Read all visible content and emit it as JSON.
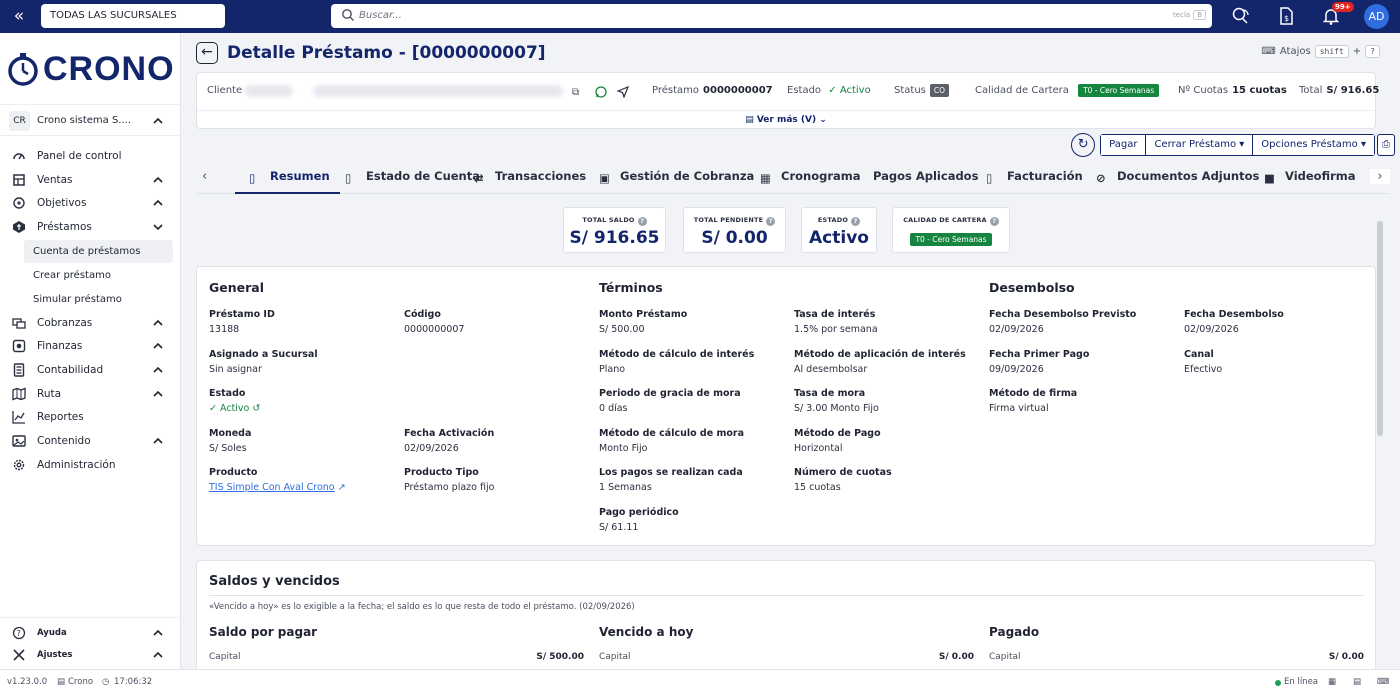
{
  "topbar": {
    "branch": "TODAS LAS SUCURSALES",
    "search_placeholder": "Buscar...",
    "search_hint": "tecla",
    "search_key": "B",
    "notifications": "99+",
    "user_initials": "AD"
  },
  "brand": {
    "name": "CRONO",
    "color": "#13256b"
  },
  "company": {
    "initials": "CR",
    "name": "Crono sistema S...."
  },
  "nav": [
    {
      "label": "Panel de control",
      "icon": "dashboard-icon"
    },
    {
      "label": "Ventas",
      "icon": "cart-icon",
      "chevron": "up"
    },
    {
      "label": "Objetivos",
      "icon": "target-icon",
      "chevron": "up"
    },
    {
      "label": "Préstamos",
      "icon": "loan-icon",
      "chevron": "down"
    },
    {
      "label": "Cobranzas",
      "icon": "collections-icon",
      "chevron": "up"
    },
    {
      "label": "Finanzas",
      "icon": "finance-icon",
      "chevron": "up"
    },
    {
      "label": "Contabilidad",
      "icon": "accounting-icon",
      "chevron": "up"
    },
    {
      "label": "Ruta",
      "icon": "map-icon",
      "chevron": "up"
    },
    {
      "label": "Reportes",
      "icon": "chart-icon"
    },
    {
      "label": "Contenido",
      "icon": "content-icon",
      "chevron": "up"
    },
    {
      "label": "Administración",
      "icon": "gear-icon"
    }
  ],
  "loan_sub": [
    "Cuenta de préstamos",
    "Crear préstamo",
    "Simular préstamo"
  ],
  "footer_nav": [
    {
      "label": "Ayuda"
    },
    {
      "label": "Ajustes"
    }
  ],
  "statusbar": {
    "version": "v1.23.0.0",
    "app": "Crono",
    "time": "17:06:32",
    "online": "En línea"
  },
  "page": {
    "title": "Detalle Préstamo - [0000000007]",
    "shortcuts_label": "Atajos",
    "shortcut_key": "shift",
    "shortcut_plus": "+",
    "shortcut_q": "?"
  },
  "client": {
    "label": "Cliente",
    "loan_label": "Préstamo",
    "loan_value": "0000000007",
    "state_label": "Estado",
    "state_value": "Activo",
    "status_label": "Status",
    "status_value": "CO",
    "portfolio_label": "Calidad de Cartera",
    "portfolio_value": "T0 - Cero Semanas",
    "quotas_label": "Nº Cuotas",
    "quotas_value": "15 cuotas",
    "total_label": "Total",
    "total_value": "S/ 916.65",
    "more": "Ver más (V)"
  },
  "actions": {
    "pay": "Pagar",
    "close": "Cerrar Préstamo",
    "options": "Opciones Préstamo"
  },
  "tabs": [
    "Resumen",
    "Estado de Cuenta",
    "Transacciones",
    "Gestión de Cobranza",
    "Cronograma",
    "Pagos Aplicados",
    "Facturación",
    "Documentos Adjuntos",
    "Videofirma"
  ],
  "summary": {
    "total_saldo_label": "TOTAL SALDO",
    "total_saldo": "S/ 916.65",
    "total_pendiente_label": "TOTAL PENDIENTE",
    "total_pendiente": "S/ 0.00",
    "estado_label": "ESTADO",
    "estado": "Activo",
    "cartera_label": "CALIDAD DE CARTERA",
    "cartera": "T0 - Cero Semanas"
  },
  "general": {
    "title": "General",
    "prestamo_id_label": "Préstamo ID",
    "prestamo_id": "13188",
    "codigo_label": "Código",
    "codigo": "0000000007",
    "sucursal_label": "Asignado a Sucursal",
    "sucursal": "Sin asignar",
    "estado_label": "Estado",
    "estado": "Activo",
    "moneda_label": "Moneda",
    "moneda": "S/ Soles",
    "fecha_act_label": "Fecha Activación",
    "fecha_act": "02/09/2026",
    "producto_label": "Producto",
    "producto": "TIS Simple Con Aval Crono",
    "producto_tipo_label": "Producto Tipo",
    "producto_tipo": "Préstamo plazo fijo"
  },
  "terminos": {
    "title": "Términos",
    "monto_label": "Monto Préstamo",
    "monto": "S/ 500.00",
    "tasa_label": "Tasa de interés",
    "tasa": "1.5% por semana",
    "calc_int_label": "Método de cálculo de interés",
    "calc_int": "Plano",
    "apl_int_label": "Método de aplicación de interés",
    "apl_int": "Al desembolsar",
    "gracia_label": "Periodo de gracia de mora",
    "gracia": "0 días",
    "tasa_mora_label": "Tasa de mora",
    "tasa_mora": "S/ 3.00 Monto Fijo",
    "calc_mora_label": "Método de cálculo de mora",
    "calc_mora": "Monto Fijo",
    "metodo_pago_label": "Método de Pago",
    "metodo_pago": "Horizontal",
    "frecuencia_label": "Los pagos se realizan cada",
    "frecuencia": "1 Semanas",
    "num_cuotas_label": "Número de cuotas",
    "num_cuotas": "15 cuotas",
    "pago_periodico_label": "Pago periódico",
    "pago_periodico": "S/ 61.11"
  },
  "desembolso": {
    "title": "Desembolso",
    "previsto_label": "Fecha Desembolso Previsto",
    "previsto": "02/09/2026",
    "fecha_label": "Fecha Desembolso",
    "fecha": "02/09/2026",
    "primer_pago_label": "Fecha Primer Pago",
    "primer_pago": "09/09/2026",
    "canal_label": "Canal",
    "canal": "Efectivo",
    "firma_label": "Método de firma",
    "firma": "Firma virtual"
  },
  "saldos": {
    "title": "Saldos y vencidos",
    "note": "«Vencido a hoy» es lo exigible a la fecha; el saldo es lo que resta de todo el préstamo. (02/09/2026)",
    "col1": "Saldo por pagar",
    "col2": "Vencido a hoy",
    "col3": "Pagado",
    "row_label": "Capital",
    "v1": "S/ 500.00",
    "v2": "S/ 0.00",
    "v3": "S/ 0.00"
  }
}
